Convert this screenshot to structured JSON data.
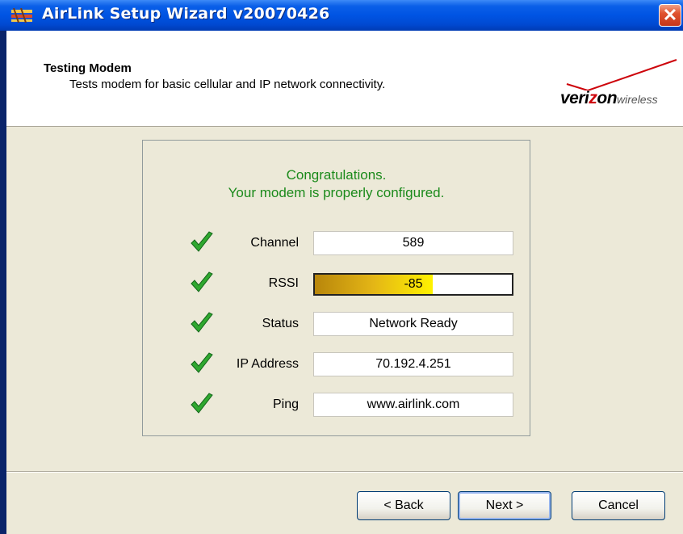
{
  "window": {
    "title": "AirLink Setup Wizard v20070426",
    "close_glyph": "✕"
  },
  "header": {
    "title": "Testing Modem",
    "subtitle": "Tests modem for basic cellular and IP network connectivity.",
    "logo": {
      "brand_prefix": "veri",
      "brand_z": "z",
      "brand_suffix": "on",
      "brand_tail": "wireless"
    }
  },
  "panel": {
    "message_line1": "Congratulations.",
    "message_line2": "Your modem is properly configured.",
    "rows": [
      {
        "label": "Channel",
        "value": "589",
        "status_icon": "check-icon"
      },
      {
        "label": "RSSI",
        "value": "-85",
        "status_icon": "check-icon",
        "level_fraction": 0.6
      },
      {
        "label": "Status",
        "value": "Network Ready",
        "status_icon": "check-icon"
      },
      {
        "label": "IP Address",
        "value": "70.192.4.251",
        "status_icon": "check-icon"
      },
      {
        "label": "Ping",
        "value": "www.airlink.com",
        "status_icon": "check-icon"
      }
    ]
  },
  "buttons": {
    "back": "< Back",
    "next": "Next >",
    "cancel": "Cancel"
  },
  "colors": {
    "accent_green": "#1b8a1b",
    "check_green": "#2fa82f",
    "titlebar_blue": "#0054e3",
    "brand_red": "#cd040b"
  }
}
